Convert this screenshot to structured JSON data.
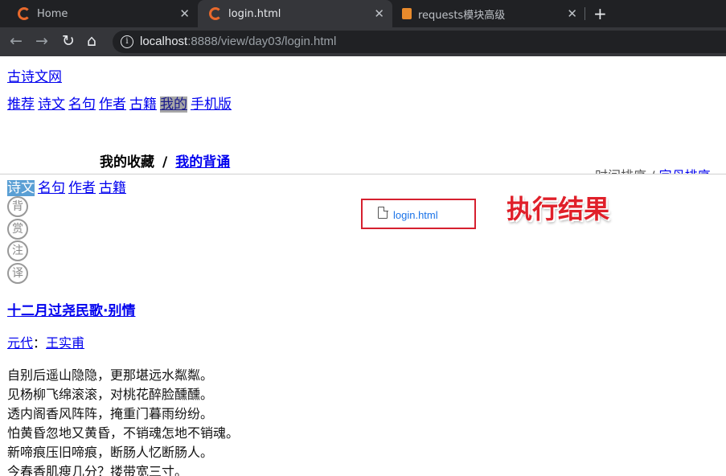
{
  "browser": {
    "tabs": [
      {
        "title": "Home",
        "active": false
      },
      {
        "title": "login.html",
        "active": true
      },
      {
        "title": "requests模块高级",
        "active": false
      }
    ],
    "close_glyph": "✕",
    "new_tab_glyph": "+",
    "url_host": "localhost",
    "url_path": ":8888/view/day03/login.html"
  },
  "page": {
    "site_link": "古诗文网",
    "top_nav": [
      "推荐",
      "诗文",
      "名句",
      "作者",
      "古籍",
      "我的",
      "手机版"
    ],
    "top_nav_active": "我的",
    "heading_static": "我的收藏",
    "heading_sep": "/",
    "heading_link": "我的背诵",
    "sort": {
      "time": "时间排序",
      "sep": "/",
      "letter": "字母排序"
    },
    "sub_nav": [
      "诗文",
      "名句",
      "作者",
      "古籍"
    ],
    "sub_nav_active": "诗文",
    "circle_buttons": [
      "背",
      "赏",
      "注",
      "译"
    ],
    "poem": {
      "title": "十二月过尧民歌·别情",
      "dynasty": "元代",
      "colon": "：",
      "author": "王实甫",
      "lines": [
        "自别后遥山隐隐，更那堪远水粼粼。",
        "见杨柳飞绵滚滚，对桃花醉脸醺醺。",
        "透内阁香风阵阵，掩重门暮雨纷纷。",
        "怕黄昏忽地又黄昏，不销魂怎地不销魂。",
        "新啼痕压旧啼痕，断肠人忆断肠人。",
        "今春香肌瘦几分？搂带宽三寸。"
      ]
    }
  },
  "overlay": {
    "file_name": "login.html",
    "result_label": "执行结果"
  },
  "colors": {
    "accent_red": "#d6202f",
    "link": "#0000ee",
    "tab_bg": "#202124",
    "active_tab_bg": "#35363a"
  }
}
